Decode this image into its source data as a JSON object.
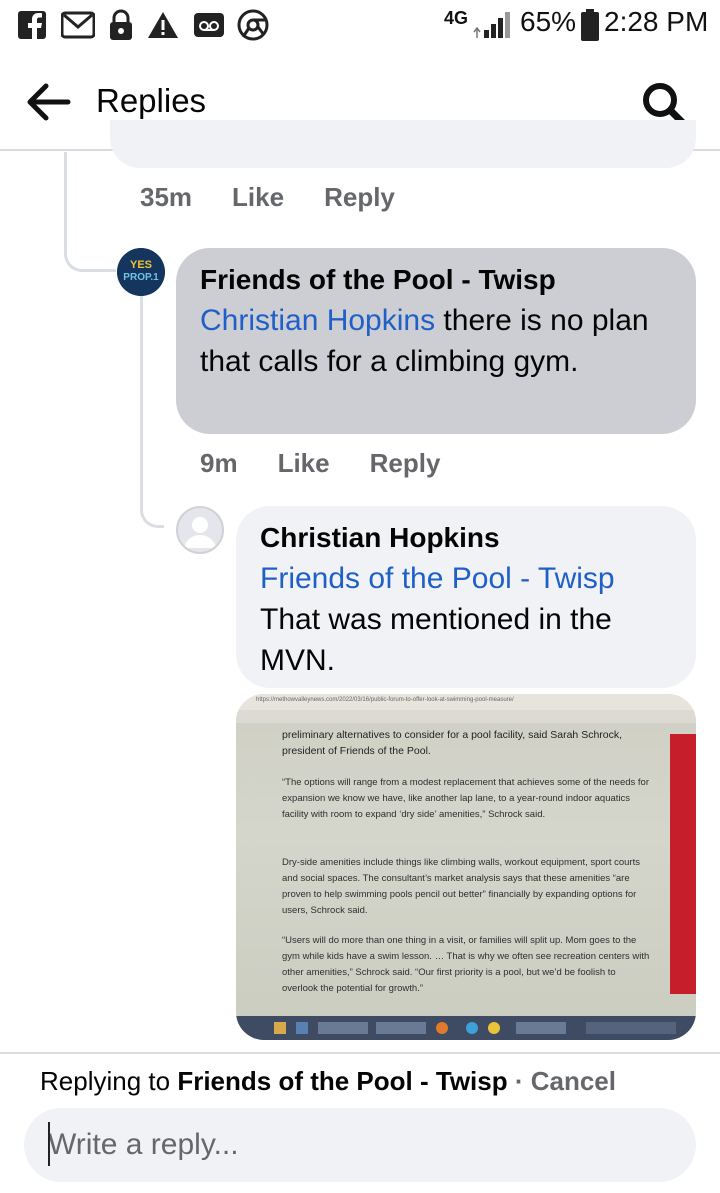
{
  "status_bar": {
    "network": "4G",
    "battery": "65%",
    "time": "2:28 PM",
    "left_icons": [
      "facebook-icon",
      "gmail-icon",
      "lock-icon",
      "warning-icon",
      "voicemail-icon",
      "chrome-icon"
    ]
  },
  "header": {
    "title": "Replies",
    "back_icon": "arrow-left-icon",
    "search_icon": "search-icon"
  },
  "comments": [
    {
      "time": "35m",
      "like_label": "Like",
      "reply_label": "Reply"
    },
    {
      "author": "Friends of the Pool - Twisp",
      "avatar_text": "YES PROP.1",
      "mention": "Christian Hopkins",
      "text": " there is no plan that calls for a climbing gym.",
      "time": "9m",
      "like_label": "Like",
      "reply_label": "Reply"
    },
    {
      "author": "Christian Hopkins",
      "mention": "Friends of the Pool - Twisp",
      "text": "That was mentioned in the MVN."
    }
  ],
  "attachment": {
    "url": "https://methowvalleynews.com/2022/03/16/public-forum-to-offer-look-at-swimming-pool-measure/",
    "paragraphs": [
      "preliminary alternatives to consider for a pool facility, said Sarah Schrock, president of Friends of the Pool.",
      "“The options will range from a modest replacement that achieves some of the needs for expansion we know we have, like another lap lane, to a year-round indoor aquatics facility with room to expand ‘dry side’ amenities,” Schrock said.",
      "Dry-side amenities include things like climbing walls, workout equipment, sport courts and social spaces. The consultant’s market analysis says that these amenities “are proven to help swimming pools pencil out better” financially by expanding options for users, Schrock said.",
      "“Users will do more than one thing in a visit, or families will split up. Mom goes to the gym while kids have a swim lesson. … That is why we often see recreation centers with other amenities,” Schrock said. “Our first priority is a pool, but we’d be foolish to overlook the potential for growth.”"
    ]
  },
  "footer": {
    "replying_prefix": "Replying to ",
    "replying_to": "Friends of the Pool - Twisp",
    "separator": " · ",
    "cancel_label": "Cancel",
    "input_placeholder": "Write a reply..."
  },
  "colors": {
    "mention": "#1f5fc8",
    "bubble": "#f0f2f5",
    "bubble_highlight": "#ccced3",
    "muted_text": "#65676b"
  }
}
